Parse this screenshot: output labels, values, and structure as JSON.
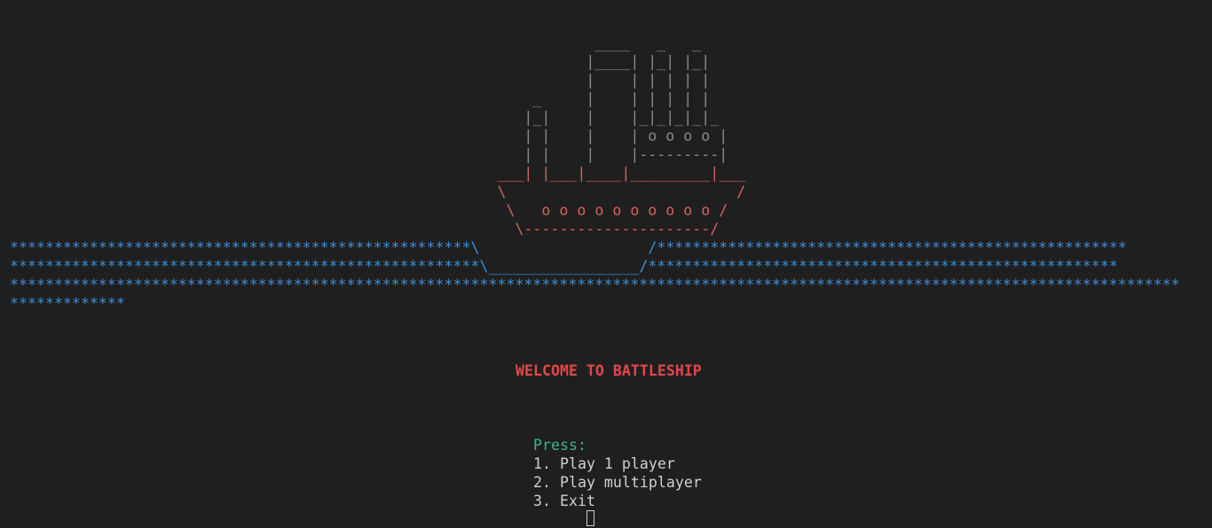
{
  "ship": {
    "top_lines": [
      "                                                                  ____   _   _",
      "                                                                 |____| |_| |_|",
      "                                                                 |    | | | | |",
      "                                                           _     |    | | | | |",
      "                                                          |_|    |    |_|_|_|_|_",
      "                                                          | |    |    | o o o o |",
      "                                                          | |    |    |---------|",
      "                                                       ___| |___|____|_________|___"
    ],
    "hull_lines": [
      "                                                       \\                          /",
      "                                                        \\   o o o o o o o o o o /",
      "                                                         \\---------------------/"
    ]
  },
  "sea": {
    "line1_left": "****************************************************",
    "line1_mid_a": "\\",
    "line1_gap": "                   ",
    "line1_mid_b": "/",
    "line1_right": "*****************************************************",
    "line2_left": "*****************************************************",
    "line2_mid": "\\_________________/",
    "line2_right": "*****************************************************",
    "line3": "************************************************************************************************************************************",
    "line4": "*************"
  },
  "title": "WELCOME TO BATTLESHIP",
  "menu": {
    "prompt": "Press:",
    "options": [
      "1. Play 1 player",
      "2. Play multiplayer",
      "3. Exit"
    ]
  },
  "colors": {
    "background": "#1f1f1f",
    "ship_top": "#8a8a8a",
    "ship_hull": "#d7625a",
    "sea": "#3e8fd8",
    "title": "#e2484a",
    "prompt": "#3fb58f"
  }
}
